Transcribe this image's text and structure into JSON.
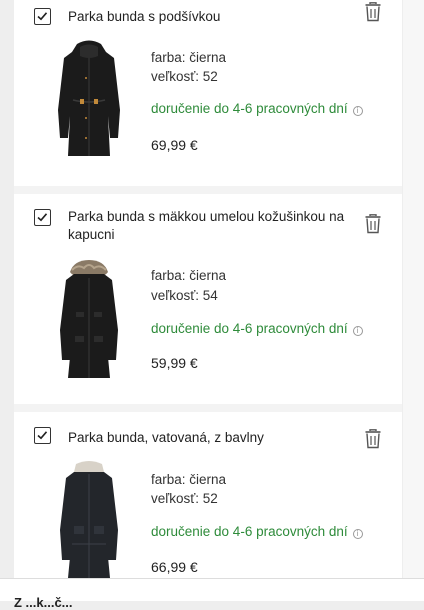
{
  "cart": {
    "items": [
      {
        "title": "Parka bunda s podšívkou",
        "color": "farba: čierna",
        "size": "veľkosť: 52",
        "delivery": "doručenie do 4-6 pracovných dní",
        "price": "69,99 €",
        "checked": true,
        "thumbnail": "black-parka-hooded-icon"
      },
      {
        "title": "Parka bunda s mäkkou umelou kožušinkou na kapucni",
        "color": "farba: čierna",
        "size": "veľkosť: 54",
        "delivery": "doručenie do 4-6 pracovných dní",
        "price": "59,99 €",
        "checked": true,
        "thumbnail": "black-parka-fur-hood-icon"
      },
      {
        "title": "Parka bunda, vatovaná, z bavlny",
        "color": "farba: čierna",
        "size": "veľkosť: 52",
        "delivery": "doručenie do 4-6 pracovných dní",
        "price": "66,99 €",
        "checked": true,
        "thumbnail": "black-parka-quilted-icon"
      }
    ],
    "remove_icon": "trash-icon",
    "delivery_info_icon": "info-icon",
    "delivery_info_glyph": "i"
  },
  "bottom": {
    "label": "Z ...k...č..."
  },
  "colors": {
    "delivery_green": "#2e8b3a",
    "background": "#eeeeee",
    "panel": "#ffffff"
  }
}
